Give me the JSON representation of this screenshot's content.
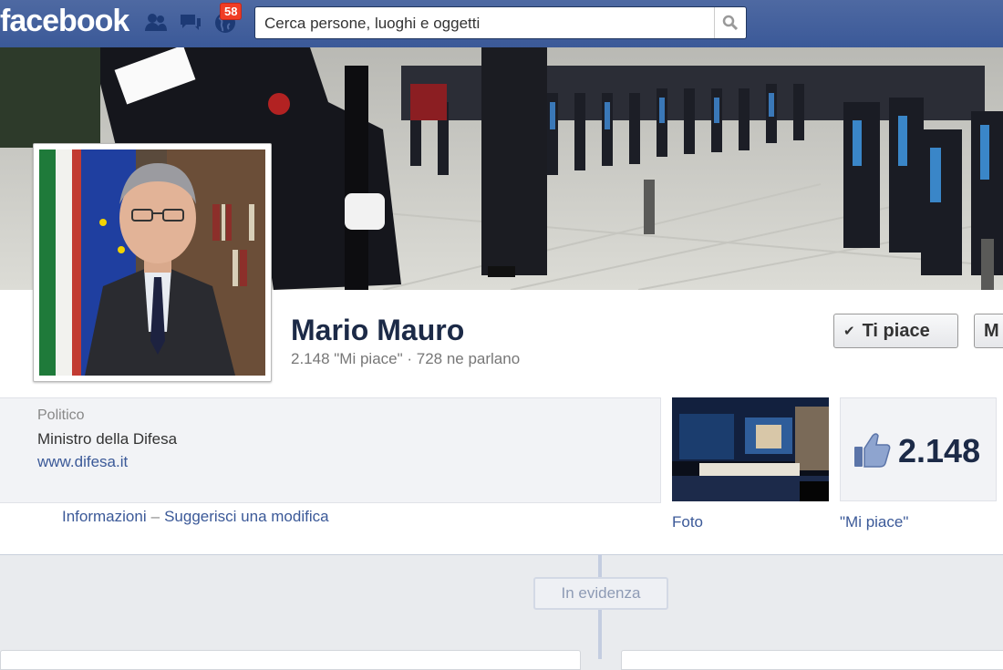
{
  "topbar": {
    "logo": "facebook",
    "notification_count": "58",
    "search_placeholder": "Cerca persone, luoghi e oggetti"
  },
  "profile": {
    "name": "Mario Mauro",
    "stats": "2.148 \"Mi piace\" · 728 ne parlano",
    "like_button": "Ti piace",
    "more_button": "M"
  },
  "about": {
    "category": "Politico",
    "description": "Ministro della Difesa",
    "website": "www.difesa.it",
    "info_link": "Informazioni",
    "separator": "–",
    "suggest_link": "Suggerisci una modifica"
  },
  "apps": {
    "photos_label": "Foto",
    "likes_count": "2.148",
    "likes_label": "\"Mi piace\""
  },
  "timeline": {
    "highlights_label": "In evidenza"
  },
  "colors": {
    "brand": "#3b5998",
    "badge": "#f03d25"
  }
}
